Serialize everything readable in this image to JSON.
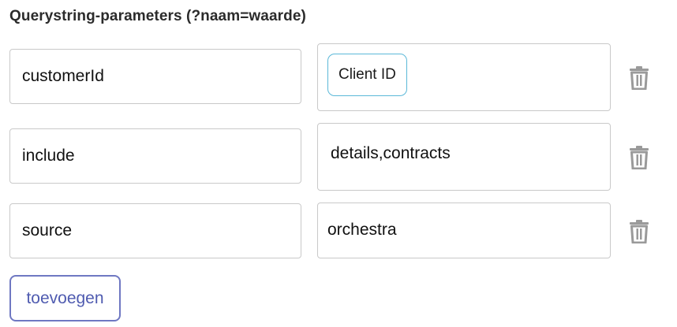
{
  "section": {
    "title": "Querystring-parameters (?naam=waarde)"
  },
  "params": [
    {
      "key": "customerId",
      "value_chip": "Client ID"
    },
    {
      "key": "include",
      "value": "details,contracts"
    },
    {
      "key": "source",
      "value": "orchestra"
    }
  ],
  "add_button_label": "toevoegen",
  "icons": {
    "delete": "trash-icon"
  },
  "colors": {
    "chip_border": "#5bb8d8",
    "add_button_border": "#6f78c2",
    "add_button_text": "#4f5bb0",
    "icon_gray": "#9a9a9a"
  }
}
